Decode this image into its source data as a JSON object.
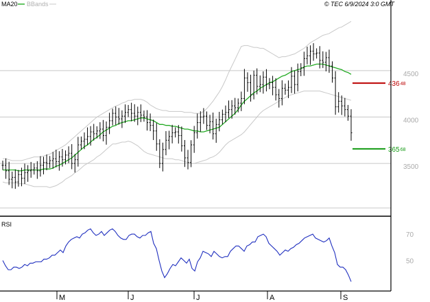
{
  "header": {
    "ma_label": "MA20",
    "bb_label": "BBands",
    "source_label": "© TEC 6/9/2024 3:0 GMT"
  },
  "colors": {
    "ma": "#22aa22",
    "bbands": "#c8c8c8",
    "candle": "#000000",
    "rsi": "#1f2fbf",
    "resistance": "#bb0000",
    "support": "#119911",
    "grid": "#c8c8c8",
    "axis": "#000000"
  },
  "chart_data": [
    {
      "type": "candlestick",
      "title": "",
      "y_ticks": [
        {
          "value": 35.0,
          "label": "3500"
        },
        {
          "value": 40.0,
          "label": "4000"
        },
        {
          "value": 45.0,
          "label": "4500"
        }
      ],
      "ylim": [
        30.2,
        51.5
      ],
      "x_ticks": [
        "M",
        "J",
        "J",
        "A",
        "S"
      ],
      "levels": [
        {
          "name": "resistance",
          "value": 43.648,
          "label_main": "436",
          "label_sup": "48"
        },
        {
          "name": "support",
          "value": 36.568,
          "label_main": "365",
          "label_sup": "68"
        }
      ],
      "close": [
        34.8,
        34.2,
        33.3,
        33.5,
        33.0,
        33.8,
        33.4,
        34.0,
        34.2,
        34.3,
        34.5,
        34.2,
        34.8,
        35.1,
        35.0,
        35.3,
        35.5,
        35.2,
        35.7,
        35.4,
        35.9,
        36.1,
        35.0,
        35.4,
        37.0,
        37.4,
        37.6,
        37.9,
        38.4,
        38.2,
        38.5,
        38.7,
        38.0,
        38.9,
        39.6,
        40.4,
        40.0,
        39.8,
        40.1,
        40.5,
        40.8,
        40.4,
        40.1,
        40.5,
        40.2,
        40.0,
        39.4,
        39.1,
        38.5,
        37.1,
        35.0,
        36.5,
        37.5,
        37.9,
        38.3,
        38.4,
        38.0,
        36.9,
        35.6,
        35.1,
        37.0,
        38.3,
        39.4,
        40.0,
        40.1,
        39.1,
        39.5,
        38.2,
        39.2,
        39.7,
        40.3,
        40.5,
        40.8,
        41.2,
        41.0,
        41.5,
        42.0,
        44.2,
        43.7,
        42.4,
        44.5,
        43.3,
        43.5,
        44.3,
        43.5,
        43.7,
        43.2,
        42.4,
        42.0,
        43.1,
        42.9,
        43.2,
        44.4,
        43.5,
        44.9,
        45.3,
        46.3,
        46.6,
        47.1,
        46.8,
        46.9,
        46.1,
        45.9,
        46.4,
        45.5,
        44.2,
        41.1,
        41.7,
        41.2,
        40.8,
        40.1,
        38.3
      ],
      "ma20": [
        34.3,
        34.3,
        34.3,
        34.3,
        34.3,
        34.2,
        34.2,
        34.3,
        34.3,
        34.3,
        34.3,
        34.3,
        34.3,
        34.4,
        34.4,
        34.4,
        34.5,
        34.7,
        34.8,
        35.0,
        35.2,
        35.4,
        35.6,
        35.9,
        36.2,
        36.5,
        36.8,
        37.0,
        37.3,
        37.6,
        37.8,
        38.1,
        38.4,
        38.6,
        38.8,
        39.0,
        39.1,
        39.3,
        39.4,
        39.5,
        39.6,
        39.6,
        39.7,
        39.8,
        39.9,
        39.9,
        39.8,
        39.7,
        39.6,
        39.4,
        39.2,
        39.2,
        39.1,
        39.1,
        39.0,
        39.0,
        38.9,
        38.8,
        38.7,
        38.7,
        38.6,
        38.5,
        38.5,
        38.4,
        38.4,
        38.5,
        38.6,
        38.7,
        38.8,
        38.9,
        39.2,
        39.5,
        39.8,
        40.1,
        40.4,
        40.8,
        41.3,
        41.7,
        42.0,
        42.3,
        42.6,
        42.8,
        43.1,
        43.3,
        43.5,
        43.7,
        43.8,
        44.0,
        44.2,
        44.4,
        44.5,
        44.7,
        44.9,
        45.0,
        45.1,
        45.2,
        45.4,
        45.5,
        45.5,
        45.6,
        45.7,
        45.7,
        45.7,
        45.6,
        45.5,
        45.4,
        45.3,
        45.2,
        45.1,
        44.9,
        44.8,
        44.6
      ],
      "bb_upper": [
        35.5,
        35.5,
        35.4,
        35.3,
        35.3,
        35.3,
        35.3,
        35.4,
        35.5,
        35.6,
        35.7,
        35.7,
        35.7,
        35.8,
        35.9,
        36.0,
        36.2,
        36.4,
        36.6,
        36.8,
        37.0,
        37.3,
        37.6,
        37.9,
        38.2,
        38.5,
        38.8,
        39.1,
        39.4,
        39.7,
        40.0,
        40.2,
        40.4,
        40.6,
        40.8,
        41.0,
        41.2,
        41.3,
        41.5,
        41.6,
        41.8,
        41.8,
        41.9,
        41.9,
        41.9,
        41.8,
        41.6,
        41.3,
        41.1,
        40.9,
        40.8,
        40.7,
        40.7,
        40.6,
        40.6,
        40.6,
        40.6,
        40.6,
        40.5,
        40.5,
        40.5,
        40.4,
        40.4,
        40.4,
        40.6,
        40.9,
        41.3,
        41.7,
        42.2,
        42.7,
        43.3,
        44.0,
        44.8,
        45.5,
        46.2,
        46.9,
        47.6,
        47.7,
        47.7,
        47.6,
        47.5,
        47.5,
        47.4,
        47.4,
        47.2,
        47.0,
        46.8,
        46.6,
        46.4,
        46.5,
        46.5,
        46.6,
        46.7,
        46.8,
        47.0,
        47.2,
        47.4,
        47.7,
        48.0,
        48.2,
        48.4,
        48.6,
        48.8,
        48.9,
        49.0,
        49.2,
        49.4,
        49.6,
        49.7,
        49.9,
        50.1,
        50.3
      ],
      "bb_lower": [
        33.0,
        32.9,
        32.9,
        32.9,
        32.9,
        32.8,
        32.8,
        32.8,
        32.7,
        32.6,
        32.5,
        32.5,
        32.5,
        32.5,
        32.5,
        32.4,
        32.5,
        32.6,
        32.8,
        33.0,
        33.3,
        33.5,
        33.7,
        34.0,
        34.2,
        34.5,
        34.8,
        35.0,
        35.2,
        35.4,
        35.7,
        35.9,
        36.2,
        36.5,
        36.8,
        37.1,
        37.1,
        37.2,
        37.3,
        37.3,
        37.4,
        37.3,
        37.1,
        36.9,
        36.6,
        36.3,
        36.1,
        36.0,
        35.9,
        35.8,
        35.7,
        35.6,
        35.5,
        35.5,
        35.5,
        35.4,
        35.4,
        35.3,
        35.2,
        35.1,
        35.0,
        35.0,
        35.1,
        35.2,
        35.3,
        35.4,
        35.6,
        35.7,
        35.9,
        36.2,
        36.6,
        37.0,
        37.3,
        37.5,
        37.7,
        37.9,
        38.1,
        38.4,
        38.8,
        39.2,
        39.6,
        40.0,
        40.4,
        40.7,
        40.9,
        41.1,
        41.3,
        41.5,
        41.7,
        41.9,
        42.1,
        42.3,
        42.4,
        42.5,
        42.6,
        42.7,
        42.8,
        42.8,
        42.8,
        42.8,
        42.8,
        42.8,
        42.7,
        42.6,
        42.5,
        42.4,
        42.3,
        42.2,
        42.1,
        42.0,
        41.9,
        41.8
      ]
    },
    {
      "type": "line",
      "title": "RSI",
      "y_ticks": [
        {
          "value": 70,
          "label": "70"
        },
        {
          "value": 50,
          "label": "50"
        }
      ],
      "ylim": [
        30,
        82
      ],
      "series": [
        {
          "values": [
            50,
            46,
            43,
            43,
            45,
            45,
            44,
            45,
            47,
            46,
            48,
            48,
            49,
            49,
            49,
            51,
            51,
            52,
            54,
            54,
            56,
            58,
            56,
            61,
            64,
            66,
            67,
            68,
            67,
            70,
            71,
            73,
            74,
            71,
            69,
            70,
            72,
            69,
            71,
            73,
            74,
            72,
            69,
            67,
            66,
            66,
            69,
            70,
            70,
            68,
            67,
            69,
            69,
            71,
            72,
            63,
            59,
            50,
            42,
            37,
            40,
            44,
            47,
            46,
            49,
            52,
            50,
            48,
            51,
            44,
            42,
            49,
            52,
            57,
            56,
            55,
            53,
            57,
            55,
            53,
            52,
            53,
            53,
            57,
            59,
            61,
            61,
            59,
            57,
            61,
            62,
            64,
            64,
            68,
            69,
            70,
            68,
            63,
            61,
            59,
            57,
            54,
            56,
            58,
            57,
            59,
            60,
            62,
            63,
            65,
            67,
            68,
            69,
            70,
            67,
            66,
            65,
            64,
            65,
            67,
            61,
            56,
            47,
            45,
            45,
            43,
            39,
            34
          ]
        }
      ]
    }
  ]
}
